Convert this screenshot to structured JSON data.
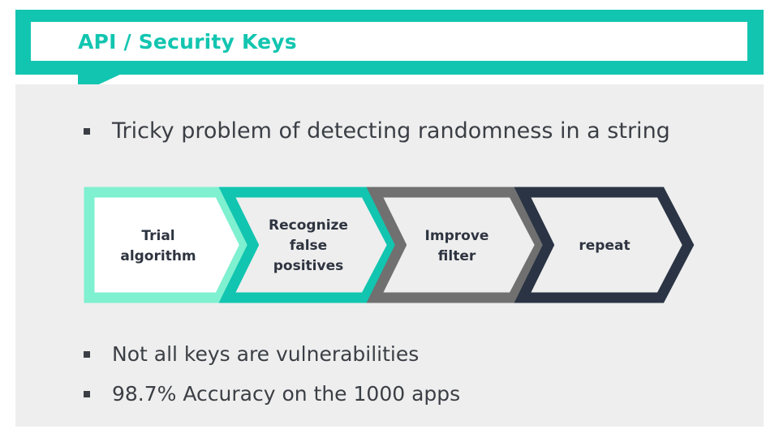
{
  "title": "API / Security Keys",
  "colors": {
    "accent": "#12c5b0",
    "chevron_1": "#7ff0d0",
    "chevron_2": "#12c5b0",
    "chevron_3": "#707070",
    "chevron_4": "#2b3444",
    "panel_bg": "#eeeeee",
    "text": "#3b3f45"
  },
  "bullets_top": [
    "Tricky problem of detecting randomness in a string"
  ],
  "process_steps": [
    "Trial algorithm",
    "Recognize false positives",
    "Improve filter",
    "repeat"
  ],
  "bullets_bottom": [
    "Not all keys are vulnerabilities",
    "98.7% Accuracy on the 1000 apps"
  ]
}
